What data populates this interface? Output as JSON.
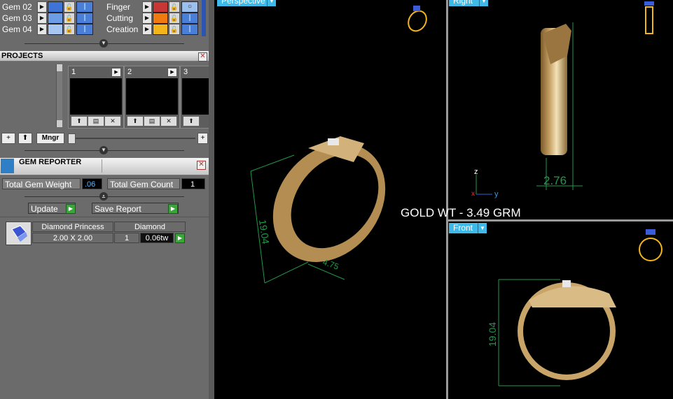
{
  "layers": {
    "left_rows": [
      {
        "name": "Gem 02",
        "color": "#3e74d6"
      },
      {
        "name": "Gem 03",
        "color": "#6e9de8"
      },
      {
        "name": "Gem 04",
        "color": "#a8c6f2"
      }
    ],
    "right_rows": [
      {
        "name": "Finger",
        "color": "#c83636"
      },
      {
        "name": "Cutting",
        "color": "#f07a10"
      },
      {
        "name": "Creation",
        "color": "#f4b41c"
      }
    ]
  },
  "projects": {
    "title": "PROJECTS",
    "cards": [
      "1",
      "2",
      "3"
    ],
    "mngr_label": "Mngr"
  },
  "gem_reporter": {
    "title": "GEM REPORTER",
    "total_weight_label": "Total Gem Weight",
    "total_weight_value": ".06",
    "total_count_label": "Total Gem Count",
    "total_count_value": "1",
    "update_label": "Update",
    "save_report_label": "Save Report",
    "table": {
      "col1_header": "Diamond Princess",
      "col2_header": "Diamond",
      "size": "2.00 X 2.00",
      "count": "1",
      "weight": "0.06tw"
    }
  },
  "viewports": {
    "perspective_label": "Perspective",
    "right_label": "Right",
    "front_label": "Front",
    "gold_weight_text": "GOLD WT - 3.49 GRM",
    "dim_diameter": "19.04",
    "dim_width_persp": "4.75",
    "dim_width_right": "2.76",
    "axis_z": "z",
    "axis_x": "x",
    "axis_y": "y",
    "accent": "#3fb9e8",
    "gold": "#c9a468"
  }
}
